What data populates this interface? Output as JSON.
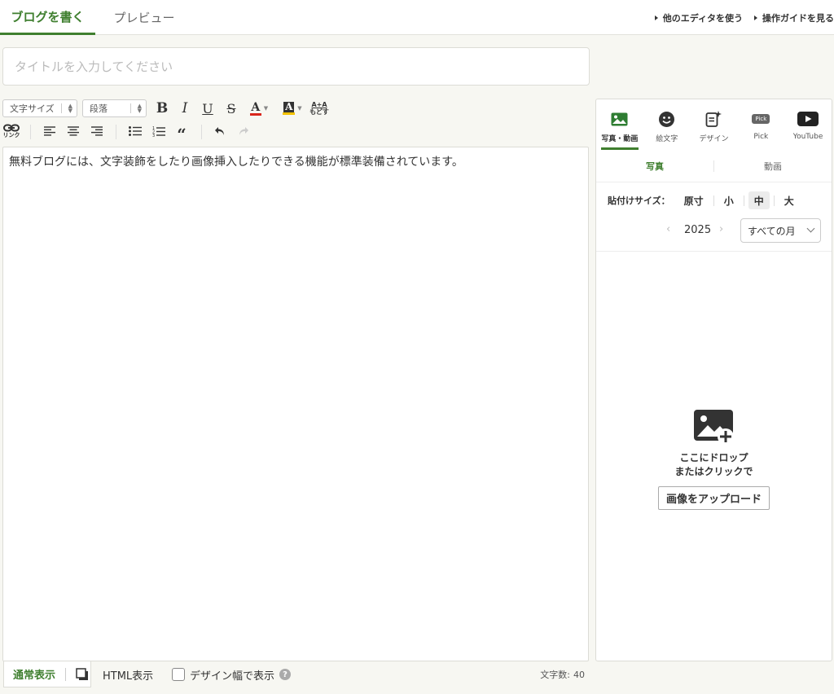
{
  "tabs": {
    "write": "ブログを書く",
    "preview": "プレビュー"
  },
  "toplinks": {
    "other_editor": "他のエディタを使う",
    "guide": "操作ガイドを見る"
  },
  "title": {
    "placeholder": "タイトルを入力してください",
    "value": ""
  },
  "toolbar": {
    "font_size": "文字サイズ",
    "paragraph": "段落",
    "bold": "B",
    "italic": "I",
    "underline": "U",
    "strike": "S",
    "font_color_glyph": "A",
    "bg_color_glyph": "A",
    "reset_top": "A+A",
    "reset_bottom": "もどす",
    "link_label": "リンク",
    "quote": "“",
    "colors": {
      "font_color": "#d9261c",
      "bg_color": "#f2c200"
    }
  },
  "editor": {
    "content": "無料ブログには、文字装飾をしたり画像挿入したりできる機能が標準装備されています。"
  },
  "bottombar": {
    "normal": "通常表示",
    "html": "HTML表示",
    "design_width": "デザイン幅で表示",
    "help": "?",
    "char_count_label": "文字数:",
    "char_count": "40"
  },
  "panel": {
    "tabs": [
      {
        "label": "写真・動画",
        "icon": "photo-icon"
      },
      {
        "label": "絵文字",
        "icon": "smiley-icon"
      },
      {
        "label": "デザイン",
        "icon": "design-icon"
      },
      {
        "label": "Pick",
        "icon": "pick-icon"
      },
      {
        "label": "YouTube",
        "icon": "youtube-icon"
      }
    ],
    "pick_badge": "Pick",
    "subtabs": {
      "photo": "写真",
      "video": "動画"
    },
    "size_label": "貼付けサイズ：",
    "sizes": [
      "原寸",
      "小",
      "中",
      "大"
    ],
    "selected_size": "中",
    "year": "2025",
    "month_select": "すべての月",
    "drop_line1": "ここにドロップ",
    "drop_line2": "またはクリックで",
    "upload_button": "画像をアップロード"
  },
  "colors": {
    "accent": "#3f7f2f"
  }
}
